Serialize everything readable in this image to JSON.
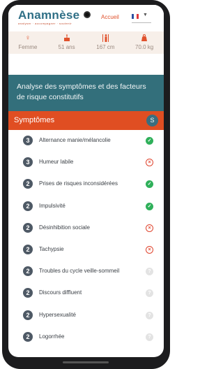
{
  "header": {
    "logo_title": "Anamnèse",
    "logo_subtitle": "analyser · accompagner · soutenir",
    "nav_home": "Accueil",
    "language_icon": "france-flag-icon"
  },
  "patient": [
    {
      "icon": "female-icon",
      "value": "Femme"
    },
    {
      "icon": "cake-icon",
      "value": "51 ans"
    },
    {
      "icon": "height-icon",
      "value": "167 cm"
    },
    {
      "icon": "weight-icon",
      "value": "70.0 kg"
    }
  ],
  "section": {
    "title": "Analyse des symptômes et des facteurs de risque constitutifs"
  },
  "symptoms_panel": {
    "title": "Symptômes",
    "badge": "S"
  },
  "symptoms": [
    {
      "rank": "3",
      "label": "Alternance manie/mélancolie",
      "status": "yes"
    },
    {
      "rank": "3",
      "label": "Humeur labile",
      "status": "no"
    },
    {
      "rank": "2",
      "label": "Prises de risques inconsidérées",
      "status": "yes"
    },
    {
      "rank": "2",
      "label": "Impulsivité",
      "status": "yes"
    },
    {
      "rank": "2",
      "label": "Désinhibition sociale",
      "status": "no"
    },
    {
      "rank": "2",
      "label": "Tachypsie",
      "status": "no"
    },
    {
      "rank": "2",
      "label": "Troubles du cycle veille-sommeil",
      "status": "none"
    },
    {
      "rank": "2",
      "label": "Discours diffluent",
      "status": "none"
    },
    {
      "rank": "2",
      "label": "Hypersexualité",
      "status": "none"
    },
    {
      "rank": "2",
      "label": "Logorrhée",
      "status": "none"
    }
  ],
  "colors": {
    "brand": "#2f6f86",
    "accent": "#e04e22",
    "yes": "#2fb05a",
    "no": "#e0452f"
  }
}
